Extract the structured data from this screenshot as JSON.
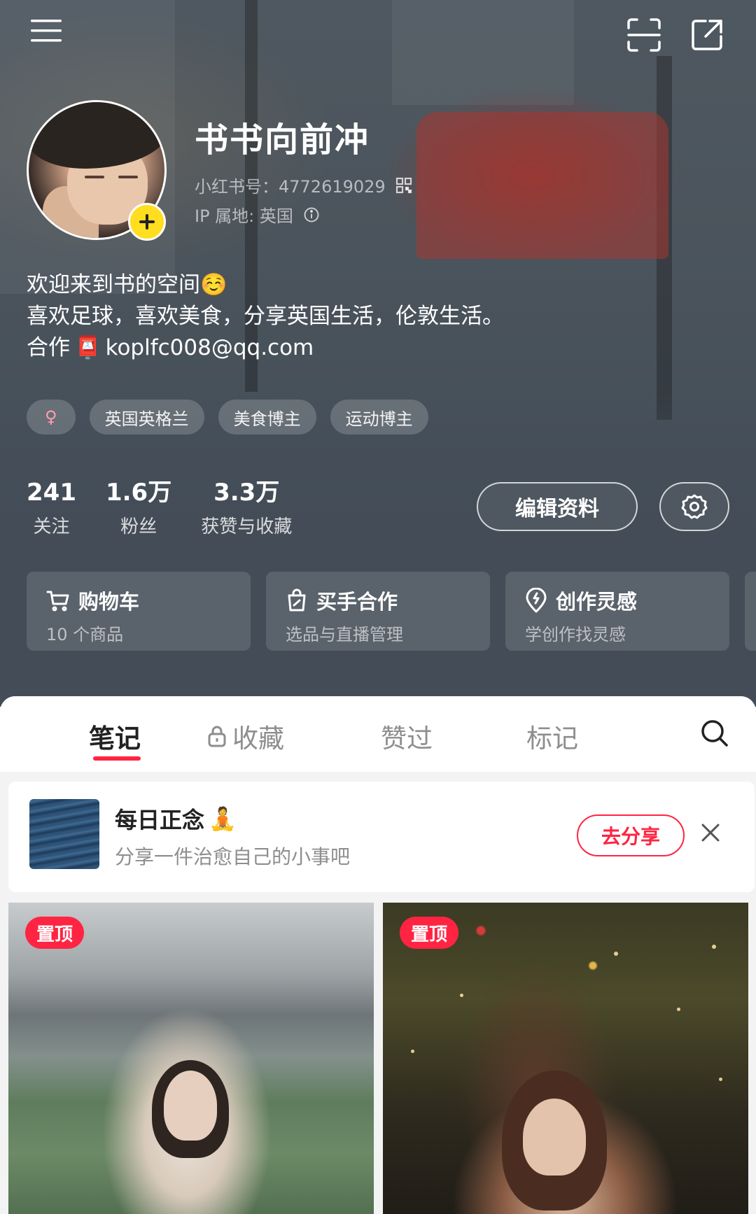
{
  "colors": {
    "accent": "#ff2442",
    "badge_yellow": "#ffdd1f",
    "header_bg": "#4b545c"
  },
  "top_bar": {
    "menu_icon": "hamburger-icon",
    "scan_icon": "scan-icon",
    "share_icon": "share-icon"
  },
  "profile": {
    "nickname": "书书向前冲",
    "id_label": "小红书号：4772619029",
    "ip_label": "IP 属地: 英国",
    "bio_line1": "欢迎来到书的空间☺️",
    "bio_line2": "喜欢足球，喜欢美食，分享英国生活，伦敦生活。",
    "bio_line3_prefix": "合作",
    "bio_line3_emoji": "📮",
    "bio_line3_email": "koplfc008@qq.com",
    "gender_symbol": "♀",
    "tags": [
      "英国英格兰",
      "美食博主",
      "运动博主"
    ]
  },
  "stats": [
    {
      "num": "241",
      "label": "关注"
    },
    {
      "num": "1.6万",
      "label": "粉丝"
    },
    {
      "num": "3.3万",
      "label": "获赞与收藏"
    }
  ],
  "actions": {
    "edit_label": "编辑资料",
    "settings_icon": "gear-icon"
  },
  "features": [
    {
      "title": "购物车",
      "sub": "10 个商品",
      "icon": "cart-icon"
    },
    {
      "title": "买手合作",
      "sub": "选品与直播管理",
      "icon": "bag-icon"
    },
    {
      "title": "创作灵感",
      "sub": "学创作找灵感",
      "icon": "bulb-icon"
    }
  ],
  "tabs": {
    "notes": "笔记",
    "collect": "收藏",
    "liked": "赞过",
    "marked": "标记"
  },
  "mindfulness": {
    "title": "每日正念",
    "emoji": "🧘",
    "subtitle": "分享一件治愈自己的小事吧",
    "share_label": "去分享"
  },
  "notes": [
    {
      "badge": "置顶"
    },
    {
      "badge": "置顶"
    }
  ]
}
